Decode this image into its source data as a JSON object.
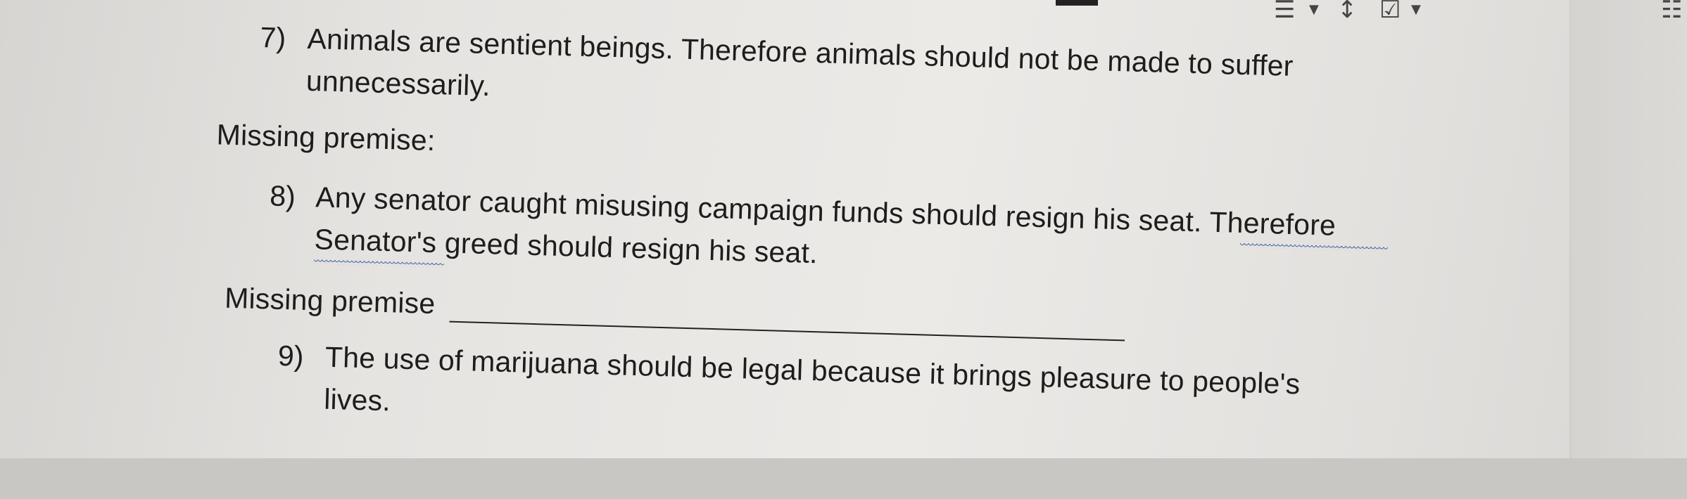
{
  "toolbar": {
    "icons": [
      "align-left-icon",
      "dropdown-icon",
      "line-spacing-icon",
      "checklist-icon",
      "dropdown-icon",
      "bulleted-list-icon"
    ]
  },
  "questions": [
    {
      "number": "7)",
      "lines": [
        "Animals are sentient beings. Therefore animals should not be made to suffer",
        "unnecessarily."
      ]
    },
    {
      "number": "8)",
      "lines": [
        "Any senator caught misusing campaign funds should resign his seat. Therefore",
        "Senator's greed should resign his seat."
      ]
    },
    {
      "number": "9)",
      "lines": [
        "The use of marijuana should be legal because it brings pleasure to people's",
        "lives."
      ]
    }
  ],
  "prompts": {
    "missing_premise_1": "Missing premise:",
    "missing_premise_2": "Missing premise"
  }
}
